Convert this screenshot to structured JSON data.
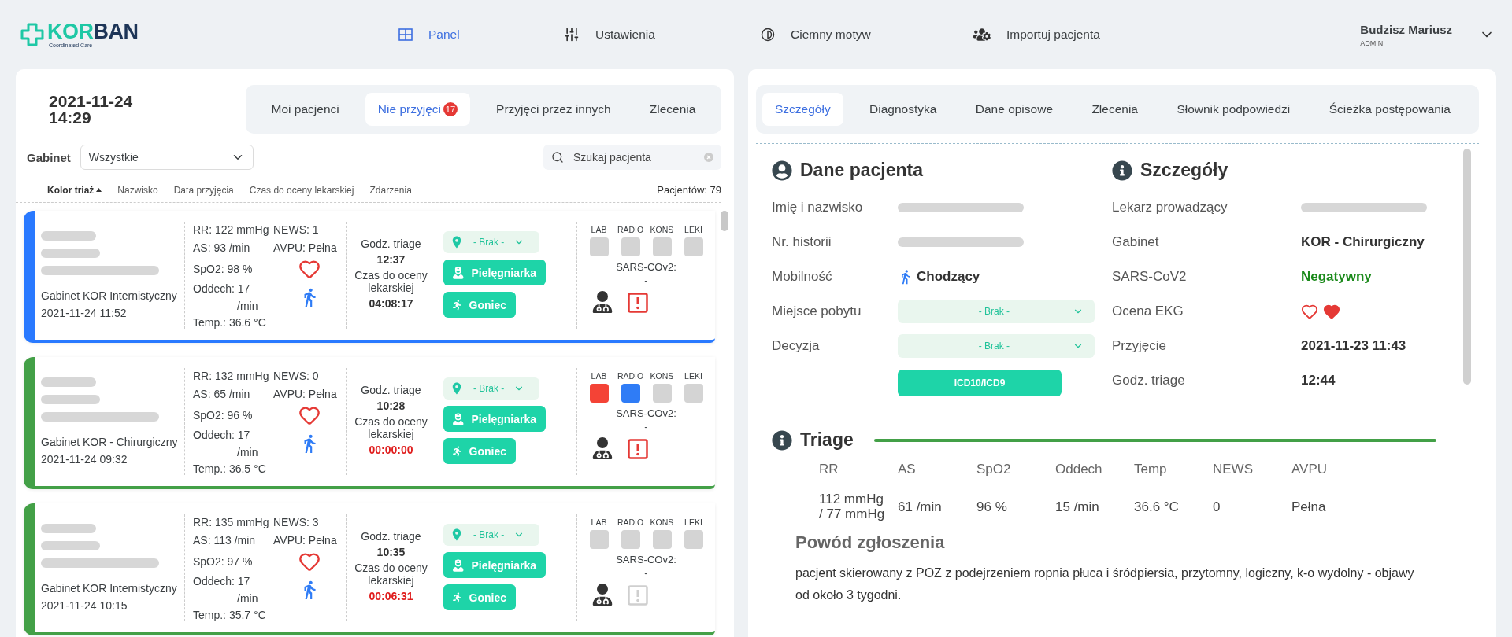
{
  "header": {
    "logo": {
      "part_1": "KOR",
      "part_2": "BAN",
      "tagline": "Coordinated Care"
    },
    "nav": [
      {
        "label": "Panel",
        "selected": true
      },
      {
        "label": "Ustawienia",
        "selected": false
      },
      {
        "label": "Ciemny motyw",
        "selected": false
      },
      {
        "label": "Importuj pacjenta",
        "selected": false
      }
    ],
    "user": {
      "name": "Budzisz Mariusz",
      "role": "ADMIN"
    }
  },
  "left": {
    "date": "2021-11-24",
    "time": "14:29",
    "tabs": [
      {
        "label": "Moi pacjenci",
        "selected": false
      },
      {
        "label": "Nie przyjęci",
        "selected": true,
        "badge": "17"
      },
      {
        "label": "Przyjęci przez innych",
        "selected": false
      },
      {
        "label": "Zlecenia",
        "selected": false
      }
    ],
    "filter": {
      "label": "Gabinet",
      "value": "Wszystkie"
    },
    "search": {
      "placeholder": "Szukaj pacjenta"
    },
    "sort": [
      {
        "label": "Kolor triaż",
        "active": true
      },
      {
        "label": "Nazwisko",
        "active": false
      },
      {
        "label": "Data przyjęcia",
        "active": false
      },
      {
        "label": "Czas do oceny lekarskiej",
        "active": false
      },
      {
        "label": "Zdarzenia",
        "active": false
      }
    ],
    "count": "Pacjentów: 79",
    "patients": [
      {
        "color": "#2979ff",
        "gabinet": "Gabinet KOR Internistyczny",
        "admitted": "2021-11-24 11:52",
        "rr": "RR: 122 mmHg",
        "news": "NEWS: 1",
        "as": "AS: 93 /min",
        "avpu": "AVPU: Pełna",
        "spo2": "SpO2: 98 %",
        "oddech": "Oddech: 17",
        "oddech_unit": "/min",
        "temp": "Temp.: 36.6 °C",
        "triage_label": "Godz. triage",
        "triage_time": "12:37",
        "eval_label": "Czas do oceny lekarskiej",
        "eval_time": "04:08:17",
        "overdue": false,
        "location": "- Brak -",
        "nurse": "Pielęgniarka",
        "runner": "Goniec",
        "tests": [
          {
            "label": "LAB",
            "color": "#d4d4d4"
          },
          {
            "label": "RADIO",
            "color": "#d4d4d4"
          },
          {
            "label": "KONS",
            "color": "#d4d4d4"
          },
          {
            "label": "LEKI",
            "color": "#d4d4d4"
          }
        ],
        "sars_label": "SARS-COv2:",
        "sars_value": "-",
        "alert": true
      },
      {
        "color": "#43a047",
        "gabinet": "Gabinet KOR - Chirurgiczny",
        "admitted": "2021-11-24 09:32",
        "rr": "RR: 132 mmHg",
        "news": "NEWS: 0",
        "as": "AS: 65 /min",
        "avpu": "AVPU: Pełna",
        "spo2": "SpO2: 96 %",
        "oddech": "Oddech: 17",
        "oddech_unit": "/min",
        "temp": "Temp.: 36.5 °C",
        "triage_label": "Godz. triage",
        "triage_time": "10:28",
        "eval_label": "Czas do oceny lekarskiej",
        "eval_time": "00:00:00",
        "overdue": true,
        "location": "- Brak -",
        "nurse": "Pielęgniarka",
        "runner": "Goniec",
        "tests": [
          {
            "label": "LAB",
            "color": "#f44336"
          },
          {
            "label": "RADIO",
            "color": "#2f7cf6"
          },
          {
            "label": "KONS",
            "color": "#d4d4d4"
          },
          {
            "label": "LEKI",
            "color": "#d4d4d4"
          }
        ],
        "sars_label": "SARS-COv2:",
        "sars_value": "-",
        "alert": true
      },
      {
        "color": "#43a047",
        "gabinet": "Gabinet KOR Internistyczny",
        "admitted": "2021-11-24 10:15",
        "rr": "RR: 135 mmHg",
        "news": "NEWS: 3",
        "as": "AS: 113 /min",
        "avpu": "AVPU: Pełna",
        "spo2": "SpO2: 97 %",
        "oddech": "Oddech: 17",
        "oddech_unit": "/min",
        "temp": "Temp.: 35.7 °C",
        "triage_label": "Godz. triage",
        "triage_time": "10:35",
        "eval_label": "Czas do oceny lekarskiej",
        "eval_time": "00:06:31",
        "overdue": true,
        "location": "- Brak -",
        "nurse": "Pielęgniarka",
        "runner": "Goniec",
        "tests": [
          {
            "label": "LAB",
            "color": "#d4d4d4"
          },
          {
            "label": "RADIO",
            "color": "#d4d4d4"
          },
          {
            "label": "KONS",
            "color": "#d4d4d4"
          },
          {
            "label": "LEKI",
            "color": "#d4d4d4"
          }
        ],
        "sars_label": "SARS-COv2:",
        "sars_value": "-",
        "alert": false
      }
    ]
  },
  "right": {
    "tabs": [
      {
        "label": "Szczegóły",
        "selected": true
      },
      {
        "label": "Diagnostyka",
        "selected": false
      },
      {
        "label": "Dane opisowe",
        "selected": false
      },
      {
        "label": "Zlecenia",
        "selected": false
      },
      {
        "label": "Słownik podpowiedzi",
        "selected": false
      },
      {
        "label": "Ścieżka postępowania",
        "selected": false
      }
    ],
    "patient": {
      "title": "Dane pacjenta",
      "rows": [
        {
          "label": "Imię i nazwisko",
          "kind": "blurred"
        },
        {
          "label": "Nr. historii",
          "kind": "blurred"
        },
        {
          "label": "Mobilność",
          "kind": "mobility",
          "value": "Chodzący"
        },
        {
          "label": "Miejsce pobytu",
          "kind": "select",
          "value": "- Brak -"
        },
        {
          "label": "Decyzja",
          "kind": "select",
          "value": "- Brak -"
        }
      ],
      "button": "ICD10/ICD9"
    },
    "details": {
      "title": "Szczegóły",
      "rows": [
        {
          "label": "Lekarz prowadzący",
          "kind": "blurred"
        },
        {
          "label": "Gabinet",
          "kind": "text",
          "value": "KOR - Chirurgiczny"
        },
        {
          "label": "SARS-CoV2",
          "kind": "status",
          "value": "Negatywny",
          "color": "#1b8a1b"
        },
        {
          "label": "Ocena EKG",
          "kind": "hearts",
          "hearts": [
            {
              "filled": false
            },
            {
              "filled": true
            }
          ]
        },
        {
          "label": "Przyjęcie",
          "kind": "text",
          "value": "2021-11-23 11:43"
        },
        {
          "label": "Godz. triage",
          "kind": "text",
          "value": "12:44"
        }
      ]
    },
    "triage": {
      "title": "Triage",
      "columns": [
        {
          "label": "RR",
          "value": "112 mmHg / 77 mmHg"
        },
        {
          "label": "AS",
          "value": "61 /min"
        },
        {
          "label": "SpO2",
          "value": "96 %"
        },
        {
          "label": "Oddech",
          "value": "15 /min"
        },
        {
          "label": "Temp",
          "value": "36.6 °C"
        },
        {
          "label": "NEWS",
          "value": "0"
        },
        {
          "label": "AVPU",
          "value": "Pełna"
        }
      ]
    },
    "reason": {
      "title": "Powód zgłoszenia",
      "text": "pacjent skierowany z POZ z podejrzeniem ropnia płuca i śródpiersia, przytomny, logiczny, k-o wydolny - objawy od około 3 tygodni."
    }
  }
}
